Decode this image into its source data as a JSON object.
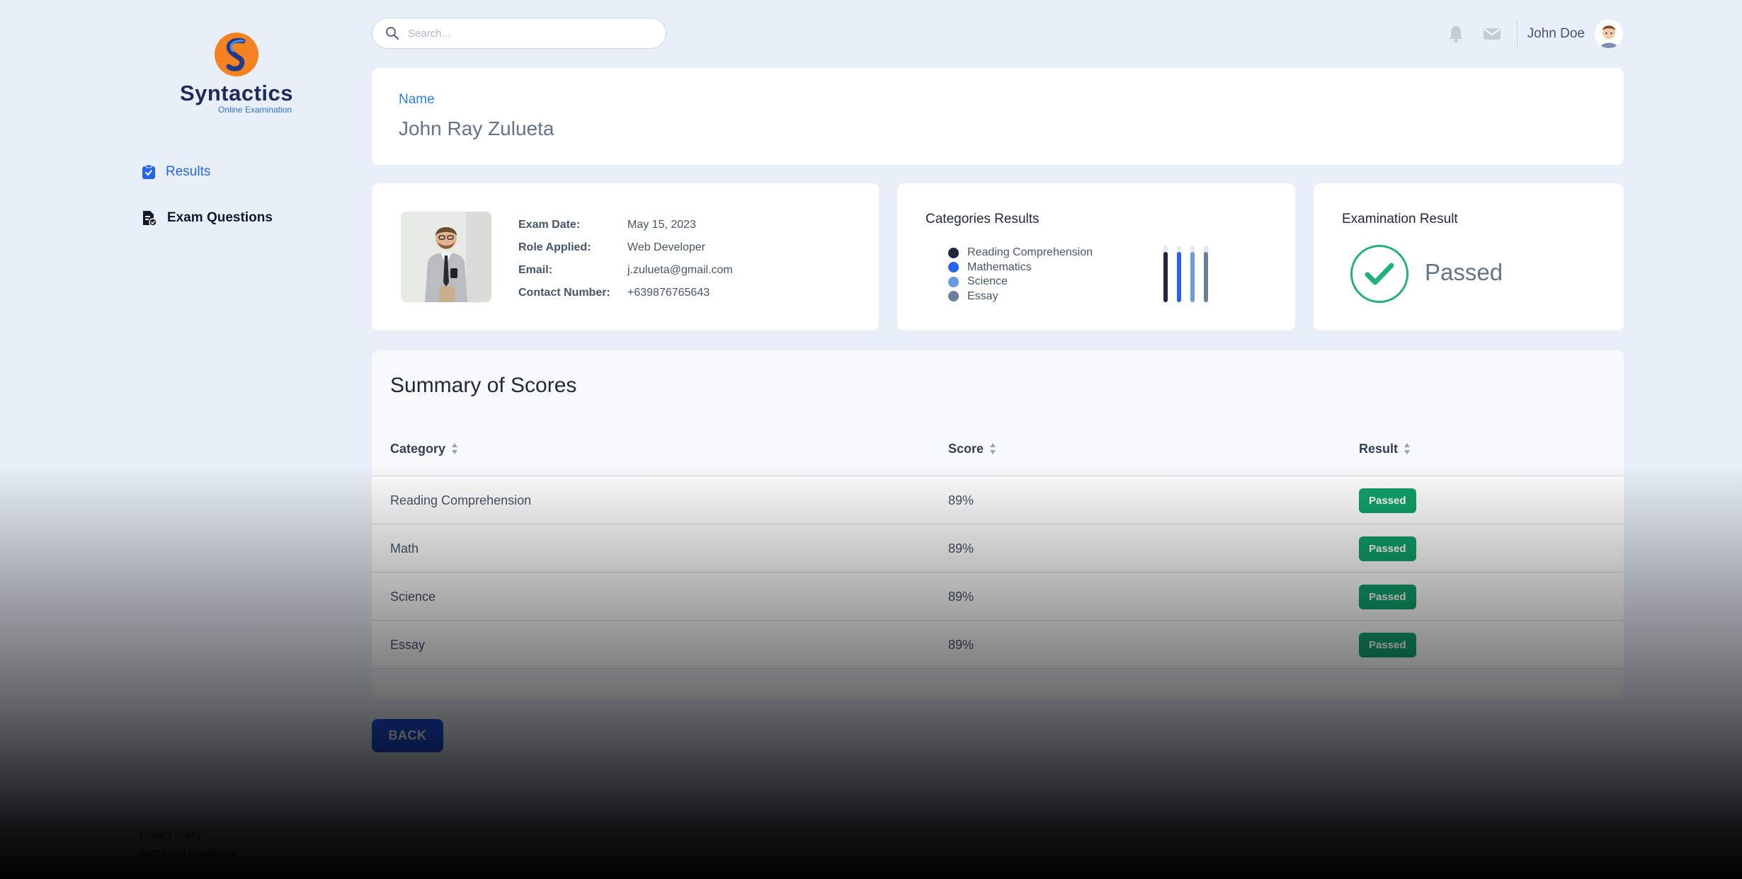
{
  "brand": {
    "name": "Syntactics",
    "subtitle": "Online Examination"
  },
  "sidebar": {
    "items": [
      {
        "label": "Results",
        "icon": "clipboard-check-icon",
        "active": true
      },
      {
        "label": "Exam Questions",
        "icon": "document-check-icon",
        "active": false
      }
    ],
    "footer": [
      "Privacy Policy",
      "Terms and Conditions"
    ]
  },
  "search": {
    "placeholder": "Search..."
  },
  "header": {
    "user_name": "John Doe"
  },
  "candidate": {
    "name_label": "Name",
    "name": "John Ray Zulueta",
    "details": [
      {
        "label": "Exam Date:",
        "value": "May 15, 2023"
      },
      {
        "label": "Role Applied:",
        "value": "Web Developer"
      },
      {
        "label": "Email:",
        "value": "j.zulueta@gmail.com"
      },
      {
        "label": "Contact Number:",
        "value": "+639876765643"
      }
    ]
  },
  "categories_results": {
    "title": "Categories Results",
    "legend": [
      {
        "name": "Reading Comprehension",
        "color": "#1e293b"
      },
      {
        "name": "Mathematics",
        "color": "#2563eb"
      },
      {
        "name": "Science",
        "color": "#6a9be0"
      },
      {
        "name": "Essay",
        "color": "#6b7f99"
      }
    ]
  },
  "chart_data": {
    "type": "bar",
    "categories": [
      "Reading Comprehension",
      "Mathematics",
      "Science",
      "Essay"
    ],
    "values": [
      89,
      89,
      89,
      89
    ],
    "ylim": [
      0,
      100
    ],
    "colors": [
      "#1e293b",
      "#2563eb",
      "#6a9be0",
      "#6b7f99"
    ]
  },
  "exam_result": {
    "title": "Examination Result",
    "status": "Passed",
    "accent": "#22b07d"
  },
  "summary": {
    "title": "Summary of Scores",
    "columns": [
      "Category",
      "Score",
      "Result"
    ],
    "rows": [
      {
        "category": "Reading Comprehension",
        "score": "89%",
        "result": "Passed"
      },
      {
        "category": "Math",
        "score": "89%",
        "result": "Passed"
      },
      {
        "category": "Science",
        "score": "89%",
        "result": "Passed"
      },
      {
        "category": "Essay",
        "score": "89%",
        "result": "Passed"
      }
    ]
  },
  "back_label": "BACK"
}
